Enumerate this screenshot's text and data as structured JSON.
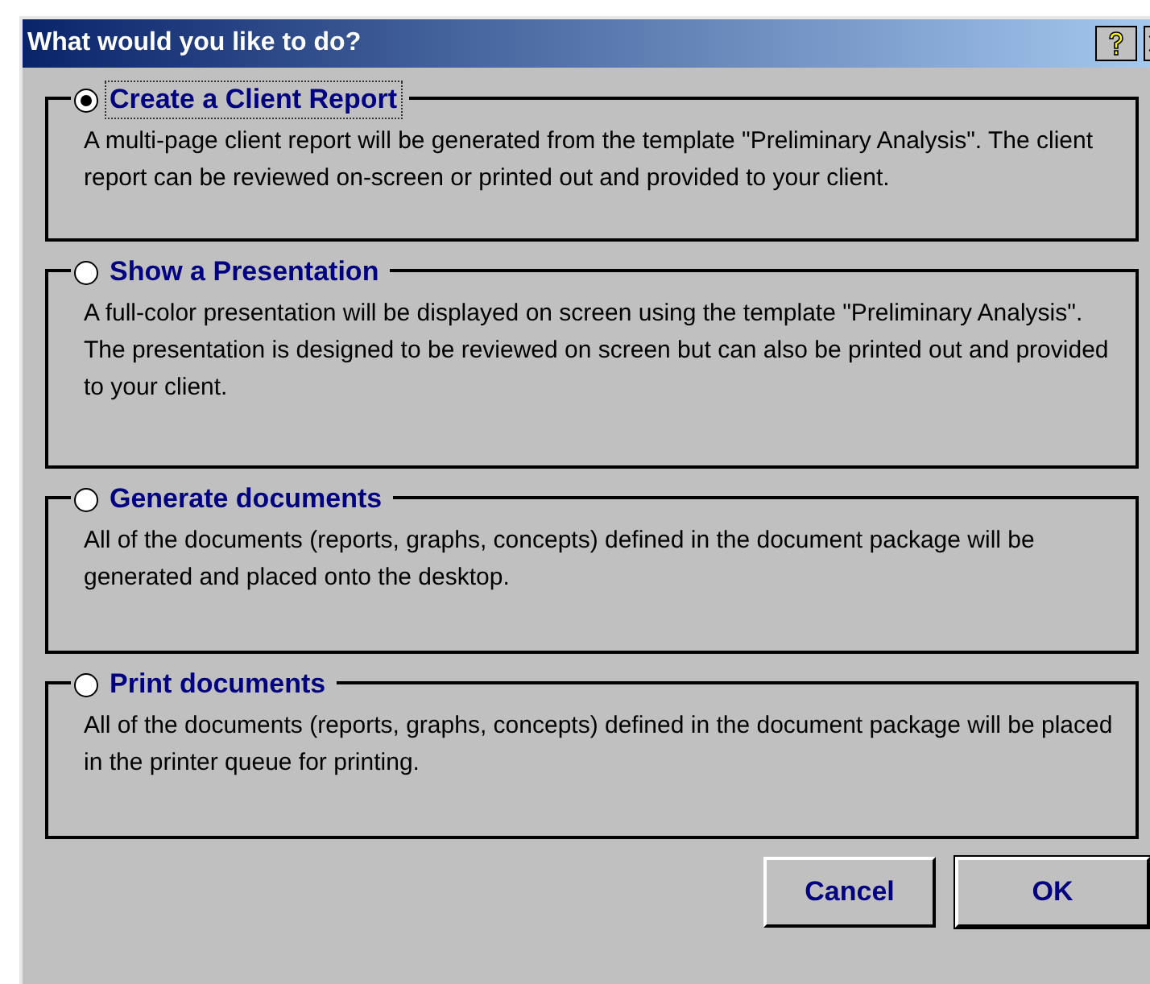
{
  "window": {
    "title": "What would you like to do?"
  },
  "options": [
    {
      "label": "Create a Client Report",
      "selected": true,
      "description": "A multi-page client report will be generated from the template \"Preliminary Analysis\". The client report can be reviewed on-screen or printed out and provided to your client."
    },
    {
      "label": "Show a Presentation",
      "selected": false,
      "description": "A full-color presentation will be displayed on screen using the template \"Preliminary Analysis\". The presentation is designed to be reviewed on screen but can also be printed out and provided to your client."
    },
    {
      "label": "Generate documents",
      "selected": false,
      "description": "All of the documents (reports, graphs, concepts) defined in the document package will be generated and placed onto the desktop."
    },
    {
      "label": "Print documents",
      "selected": false,
      "description": "All of the documents (reports, graphs, concepts) defined in the document package will be placed in the printer queue for printing."
    }
  ],
  "buttons": [
    "Cancel",
    "OK"
  ]
}
